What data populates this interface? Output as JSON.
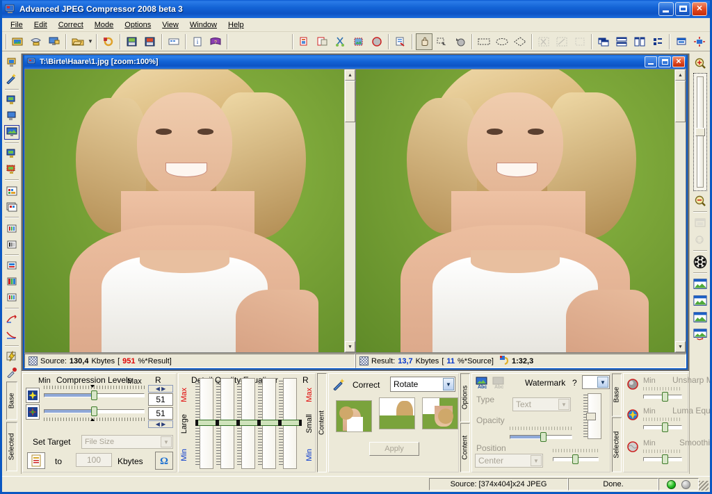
{
  "window": {
    "title": "Advanced JPEG Compressor 2008 beta 3",
    "icon": "app-icon",
    "minimize": "_",
    "maximize": "□",
    "close": "✕"
  },
  "menu": {
    "items": [
      {
        "label": "File"
      },
      {
        "label": "Edit"
      },
      {
        "label": "Correct"
      },
      {
        "label": "Mode"
      },
      {
        "label": "Options"
      },
      {
        "label": "View"
      },
      {
        "label": "Window"
      },
      {
        "label": "Help"
      }
    ]
  },
  "toolbar": {
    "groups": [
      {
        "buttons": [
          {
            "name": "open-image-icon",
            "glyph": "📂"
          },
          {
            "name": "acquire-scanner-icon",
            "glyph": "🗜"
          },
          {
            "name": "open-from-screen-icon",
            "glyph": "🖥"
          }
        ]
      },
      {
        "buttons": [
          {
            "name": "open-folder-icon",
            "glyph": "📁",
            "dropdown": true
          }
        ]
      },
      {
        "buttons": [
          {
            "name": "refresh-image-icon",
            "glyph": "🔄"
          }
        ]
      },
      {
        "buttons": [
          {
            "name": "save-image-icon",
            "glyph": "💾"
          },
          {
            "name": "save-as-icon",
            "glyph": "💾"
          }
        ]
      },
      {
        "buttons": [
          {
            "name": "batch-icon",
            "glyph": "▭"
          }
        ]
      },
      {
        "buttons": [
          {
            "name": "image-info-icon",
            "glyph": "ℹ"
          },
          {
            "name": "help-book-icon",
            "glyph": "📕"
          }
        ]
      },
      {
        "buttons": [
          {
            "name": "copy-icon",
            "glyph": "📋"
          },
          {
            "name": "paste-icon",
            "glyph": "📋"
          },
          {
            "name": "cut-selection-icon",
            "glyph": "✂"
          },
          {
            "name": "crop-icon",
            "glyph": "⛶"
          },
          {
            "name": "undo-red-circle-icon",
            "glyph": "⬤"
          }
        ]
      },
      {
        "buttons": [
          {
            "name": "preview-report-icon",
            "glyph": "🔍"
          }
        ]
      },
      {
        "buttons": [
          {
            "name": "pan-hand-tool",
            "glyph": "✋",
            "pressed": true
          },
          {
            "name": "select-rect-tool",
            "glyph": "⬚"
          },
          {
            "name": "magic-select-tool",
            "glyph": "🔮"
          }
        ]
      },
      {
        "buttons": [
          {
            "name": "marquee-rectangle-tool",
            "glyph": "▭"
          },
          {
            "name": "marquee-ellipse-tool",
            "glyph": "◯"
          },
          {
            "name": "marquee-polygon-tool",
            "glyph": "◇"
          }
        ]
      },
      {
        "buttons": [
          {
            "name": "cut-marked-icon",
            "glyph": "✂",
            "disabled": true
          },
          {
            "name": "clear-marked-icon",
            "glyph": "✂",
            "disabled": true
          },
          {
            "name": "clear-selection-icon",
            "glyph": "⬚",
            "disabled": true
          }
        ]
      },
      {
        "buttons": [
          {
            "name": "cascade-windows-icon",
            "glyph": "▤"
          },
          {
            "name": "tile-horizontal-icon",
            "glyph": "▤"
          },
          {
            "name": "tile-vertical-icon",
            "glyph": "▥"
          },
          {
            "name": "arrange-icons-icon",
            "glyph": "▦"
          }
        ]
      },
      {
        "buttons": [
          {
            "name": "window-list-icon",
            "glyph": "🗗"
          },
          {
            "name": "center-view-icon",
            "glyph": "✛"
          }
        ]
      }
    ]
  },
  "left_rail": {
    "items": [
      {
        "name": "open-image-rail-icon",
        "glyph": "🖼"
      },
      {
        "name": "auto-correct-rail-icon",
        "glyph": "✨"
      },
      {
        "name": "view-source-rail-icon",
        "glyph": "🖥"
      },
      {
        "name": "view-result-rail-icon",
        "glyph": "🖥"
      },
      {
        "name": "view-both-rail-icon",
        "glyph": "🖼",
        "framed": true
      },
      {
        "name": "compare-rail-icon",
        "glyph": "🖥"
      },
      {
        "name": "difference-rail-icon",
        "glyph": "🖥"
      },
      {
        "name": "grid-view-rail-icon",
        "glyph": "▦"
      },
      {
        "name": "multi-grid-rail-icon",
        "glyph": "▦"
      },
      {
        "name": "channels-rail-icon",
        "glyph": "▮"
      },
      {
        "name": "gray-channels-rail-icon",
        "glyph": "▮"
      },
      {
        "name": "histogram-rail-icon",
        "glyph": "▥"
      },
      {
        "name": "color-table-rail-icon",
        "glyph": "▤"
      },
      {
        "name": "palette-rail-icon",
        "glyph": "▥"
      },
      {
        "name": "curve-up-rail-icon",
        "glyph": "📈"
      },
      {
        "name": "curve-down-rail-icon",
        "glyph": "📉"
      },
      {
        "name": "quick-optimize-rail-icon",
        "glyph": "⚡"
      },
      {
        "name": "eyedropper-rail-icon",
        "glyph": "🖊"
      }
    ],
    "tab_base": "Base",
    "tab_selected": "Selected"
  },
  "right_rail": {
    "zoom_in": "zoom-in-icon",
    "zoom_out": "zoom-out-icon",
    "zoom_slider": "zoom-slider",
    "items": [
      {
        "name": "fit-window-icon",
        "glyph": "▭",
        "disabled": true
      },
      {
        "name": "zoom-1to1-icon",
        "glyph": "1:1",
        "disabled": true
      },
      {
        "name": "film-reel-icon",
        "glyph": "◉"
      },
      {
        "name": "window-thumb-1-icon",
        "glyph": "🖼"
      },
      {
        "name": "window-thumb-2-icon",
        "glyph": "🖼"
      },
      {
        "name": "window-thumb-3-icon",
        "glyph": "🖼"
      },
      {
        "name": "window-thumb-4-icon",
        "glyph": "🖼"
      },
      {
        "name": "window-close-thumb-icon",
        "glyph": "🖼"
      }
    ]
  },
  "document": {
    "title": "T:\\Birte\\Haare\\1.jpg  [zoom:100%]",
    "icon": "document-icon",
    "minimize": "_",
    "maximize": "□",
    "close": "✕",
    "source_info": {
      "prefix": "Source:",
      "size": "130,4",
      "unit": "Kbytes",
      "ratio_open": "[",
      "ratio": "951",
      "ratio_text": "%*Result]"
    },
    "result_info": {
      "prefix": "Result:",
      "size": "13,7",
      "unit": "Kbytes",
      "ratio_open": "[",
      "ratio": "11",
      "ratio_text": "%*Source]",
      "time": "1:32,3"
    }
  },
  "compression_panel": {
    "tabs": {
      "base": "Base",
      "selected": "Selected"
    },
    "title": "Compression Levels",
    "min_label": "Min",
    "max_label": "Max",
    "r_label": "R",
    "slider_luma_value": "51",
    "slider_chroma_value": "51",
    "set_target_label": "Set Target",
    "target_mode": "File Size",
    "to_label": "to",
    "target_value": "100",
    "target_unit": "Kbytes",
    "luma_icon": "luma-levels-icon",
    "chroma_icon": "chroma-levels-icon",
    "target_icon": "target-file-icon",
    "apply_target_icon": "apply-target-icon"
  },
  "equalizer_panel": {
    "title": "Detail Quality Equalizer",
    "r_label": "R",
    "left_max": "Max",
    "left_large": "Large",
    "left_min": "Min",
    "right_max": "Max",
    "right_small": "Small",
    "right_min": "Min",
    "bands": [
      50,
      50,
      50,
      50,
      50
    ]
  },
  "correct_panel": {
    "tab": "Content",
    "title": "Correct",
    "icon": "correct-wand-icon",
    "mode": "Rotate",
    "apply_label": "Apply",
    "thumbs": [
      {
        "name": "rotate-thumb-0"
      },
      {
        "name": "rotate-thumb-90"
      },
      {
        "name": "rotate-thumb-180"
      }
    ]
  },
  "watermark_panel": {
    "tab_options": "Options",
    "tab_content": "Content",
    "title": "Watermark",
    "help": "?",
    "text_icon": "watermark-text-icon",
    "image_icon": "watermark-image-icon",
    "preset": "",
    "type_label": "Type",
    "type_value": "Text",
    "opacity_label": "Opacity",
    "position_label": "Position",
    "position_value": "Center"
  },
  "enhance_panel": {
    "tabs": {
      "base": "Base",
      "selected": "Selected"
    },
    "rows": [
      {
        "title": "Unsharp Masking",
        "min_label": "Min",
        "icon": "unsharp-mask-icon",
        "value": 47
      },
      {
        "title": "Luma Equalizing",
        "min_label": "Min",
        "icon": "luma-equalize-icon",
        "value": 47
      },
      {
        "title": "Smoothing",
        "min_label": "Min",
        "icon": "smoothing-icon",
        "value": 47
      }
    ]
  },
  "statusbar": {
    "source": "Source: [374x404]x24 JPEG",
    "status": "Done.",
    "led_active": "#22bb22",
    "led_idle": "#b8b8b8"
  }
}
